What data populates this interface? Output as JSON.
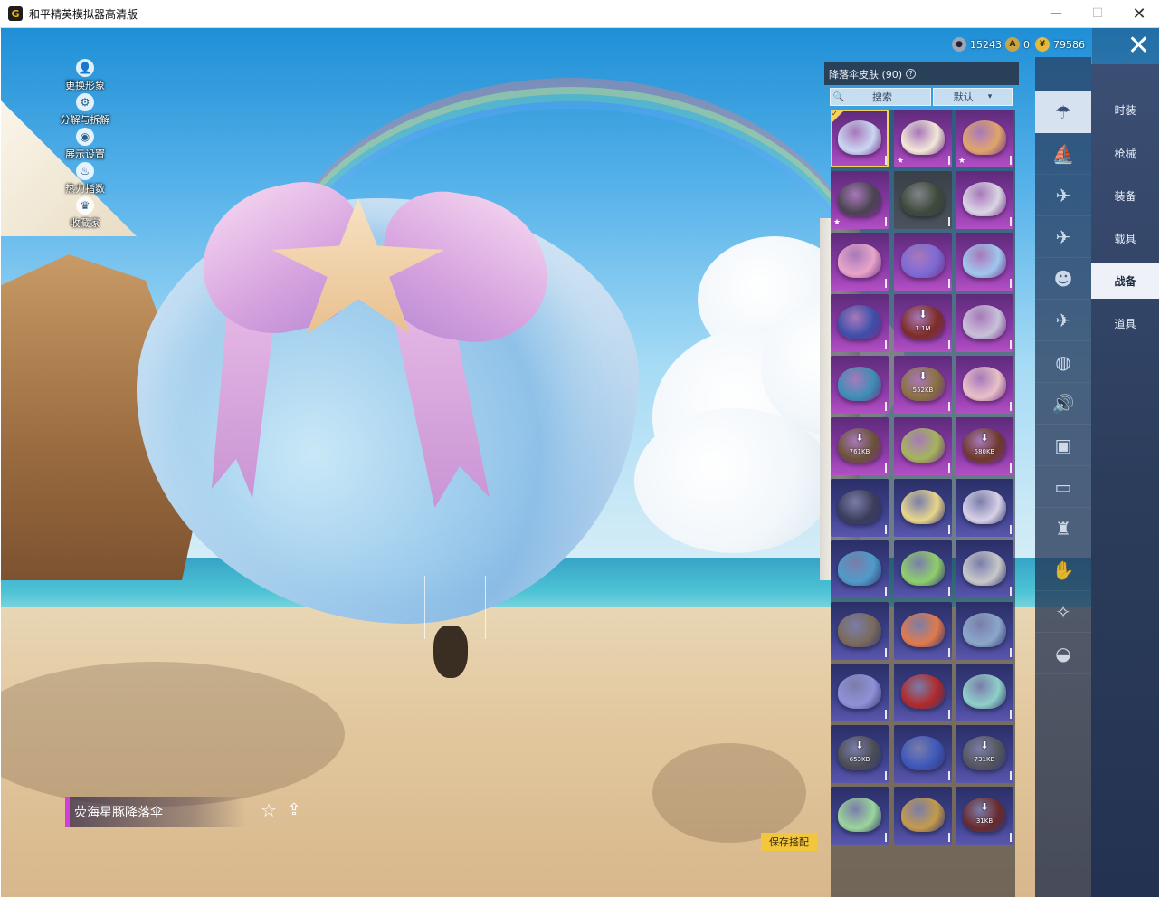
{
  "window": {
    "title": "和平精英模拟器高清版",
    "icon_glyph": "G",
    "minimize": "—",
    "maximize": "☐",
    "close": "✕"
  },
  "hud": {
    "items": [
      {
        "label": "更换形象",
        "icon": "person-icon",
        "glyph": "👤"
      },
      {
        "label": "分解与拆解",
        "icon": "gear-icon",
        "glyph": "⚙"
      },
      {
        "label": "展示设置",
        "icon": "eye-icon",
        "glyph": "◉"
      },
      {
        "label": "热力指数",
        "icon": "flame-icon",
        "glyph": "♨"
      },
      {
        "label": "收藏家",
        "icon": "collector-badge-icon",
        "glyph": "♛"
      }
    ]
  },
  "currency": [
    {
      "icon": "silver-coin-icon",
      "glyph": "●",
      "value": "15243",
      "color": "#9aa7b8"
    },
    {
      "icon": "gold-a-coin-icon",
      "glyph": "A",
      "value": "0",
      "color": "#c9a447"
    },
    {
      "icon": "gold-coin-icon",
      "glyph": "¥",
      "value": "79586",
      "color": "#e6b93a"
    }
  ],
  "close_glyph": "✕",
  "categories": [
    {
      "label": "时装",
      "active": false
    },
    {
      "label": "枪械",
      "active": false
    },
    {
      "label": "装备",
      "active": false
    },
    {
      "label": "载具",
      "active": false
    },
    {
      "label": "战备",
      "active": true
    },
    {
      "label": "道具",
      "active": false
    }
  ],
  "subcategories": [
    {
      "icon": "parachute-icon",
      "glyph": "☂",
      "active": true
    },
    {
      "icon": "boat-icon",
      "glyph": "⛵",
      "active": false
    },
    {
      "icon": "drone-icon",
      "glyph": "✈",
      "active": false
    },
    {
      "icon": "plane-icon",
      "glyph": "✈",
      "active": false
    },
    {
      "icon": "mask-face-icon",
      "glyph": "☻",
      "active": false
    },
    {
      "icon": "glider-icon",
      "glyph": "✈",
      "active": false
    },
    {
      "icon": "grenade-icon",
      "glyph": "◍",
      "active": false
    },
    {
      "icon": "speaker-icon",
      "glyph": "🔊",
      "active": false
    },
    {
      "icon": "robot-icon",
      "glyph": "▣",
      "active": false
    },
    {
      "icon": "photo-icon",
      "glyph": "▭",
      "active": false
    },
    {
      "icon": "spray-icon",
      "glyph": "♜",
      "active": false
    },
    {
      "icon": "hand-spark-icon",
      "glyph": "✋",
      "active": false
    },
    {
      "icon": "magic-wand-icon",
      "glyph": "✧",
      "active": false
    },
    {
      "icon": "landing-icon",
      "glyph": "◒",
      "active": false
    }
  ],
  "panel": {
    "header": "降落伞皮肤 (90)",
    "help_glyph": "?",
    "search_placeholder": "搜索",
    "search_glyph": "🔍",
    "sort_label": "默认",
    "sort_glyph": "▾"
  },
  "grid": [
    {
      "tier": "purple",
      "art": "#c9d7f0",
      "selected": true,
      "star": false,
      "size": ""
    },
    {
      "tier": "purple",
      "art": "#f2e9d6",
      "selected": false,
      "star": true,
      "size": ""
    },
    {
      "tier": "purple",
      "art": "#e0a56a",
      "selected": false,
      "star": true,
      "size": ""
    },
    {
      "tier": "purple",
      "art": "#4a4450",
      "selected": false,
      "star": true,
      "size": ""
    },
    {
      "tier": "grey",
      "art": "#3f4a3c",
      "selected": false,
      "star": false,
      "size": ""
    },
    {
      "tier": "purple",
      "art": "#d9d5e3",
      "selected": false,
      "star": false,
      "size": ""
    },
    {
      "tier": "purple",
      "art": "#e7a5c7",
      "selected": false,
      "star": false,
      "size": ""
    },
    {
      "tier": "purple",
      "art": "#7c6ad4",
      "selected": false,
      "star": false,
      "size": ""
    },
    {
      "tier": "purple",
      "art": "#9fc7ec",
      "selected": false,
      "star": false,
      "size": ""
    },
    {
      "tier": "purple",
      "art": "#3d4fa8",
      "selected": false,
      "star": false,
      "size": ""
    },
    {
      "tier": "purple",
      "art": "#7d2d24",
      "selected": false,
      "star": false,
      "size": "1.1M"
    },
    {
      "tier": "purple",
      "art": "#c8c1d8",
      "selected": false,
      "star": false,
      "size": ""
    },
    {
      "tier": "purple",
      "art": "#3b8fb5",
      "selected": false,
      "star": false,
      "size": ""
    },
    {
      "tier": "purple",
      "art": "#8a7240",
      "selected": false,
      "star": false,
      "size": "552KB"
    },
    {
      "tier": "purple",
      "art": "#e8c1c7",
      "selected": false,
      "star": false,
      "size": ""
    },
    {
      "tier": "purple",
      "art": "#6b5238",
      "selected": false,
      "star": false,
      "size": "761KB"
    },
    {
      "tier": "purple",
      "art": "#a4b55a",
      "selected": false,
      "star": false,
      "size": ""
    },
    {
      "tier": "purple",
      "art": "#6e3a2a",
      "selected": false,
      "star": false,
      "size": "580KB"
    },
    {
      "tier": "blue",
      "art": "#3b3d5a",
      "selected": false,
      "star": false,
      "size": ""
    },
    {
      "tier": "blue",
      "art": "#e8d68a",
      "selected": false,
      "star": false,
      "size": ""
    },
    {
      "tier": "blue",
      "art": "#d7d1e7",
      "selected": false,
      "star": false,
      "size": ""
    },
    {
      "tier": "blue",
      "art": "#4e9bc8",
      "selected": false,
      "star": false,
      "size": ""
    },
    {
      "tier": "blue",
      "art": "#8fcf6a",
      "selected": false,
      "star": false,
      "size": ""
    },
    {
      "tier": "blue",
      "art": "#c8c8c8",
      "selected": false,
      "star": false,
      "size": ""
    },
    {
      "tier": "blue",
      "art": "#7a6a5a",
      "selected": false,
      "star": false,
      "size": ""
    },
    {
      "tier": "blue",
      "art": "#e07a4a",
      "selected": false,
      "star": false,
      "size": ""
    },
    {
      "tier": "blue",
      "art": "#8aa7c8",
      "selected": false,
      "star": false,
      "size": ""
    },
    {
      "tier": "blue",
      "art": "#9090d8",
      "selected": false,
      "star": false,
      "size": ""
    },
    {
      "tier": "blue",
      "art": "#b02a2a",
      "selected": false,
      "star": false,
      "size": ""
    },
    {
      "tier": "blue",
      "art": "#8fd0c8",
      "selected": false,
      "star": false,
      "size": ""
    },
    {
      "tier": "blue",
      "art": "#4d4d55",
      "selected": false,
      "star": false,
      "size": "653KB"
    },
    {
      "tier": "blue",
      "art": "#3e57b8",
      "selected": false,
      "star": false,
      "size": ""
    },
    {
      "tier": "blue",
      "art": "#55565e",
      "selected": false,
      "star": false,
      "size": "731KB"
    },
    {
      "tier": "blue",
      "art": "#9ad59a",
      "selected": false,
      "star": false,
      "size": ""
    },
    {
      "tier": "blue",
      "art": "#c49a4a",
      "selected": false,
      "star": false,
      "size": ""
    },
    {
      "tier": "blue",
      "art": "#6a2a2a",
      "selected": false,
      "star": false,
      "size": "31KB"
    }
  ],
  "item_name": "荧海星豚降落伞",
  "fav_glyph": "☆",
  "share_glyph": "⇪",
  "save_label": "保存搭配",
  "download_glyph": "⬇",
  "star_glyph": "★",
  "check_glyph": "✓"
}
